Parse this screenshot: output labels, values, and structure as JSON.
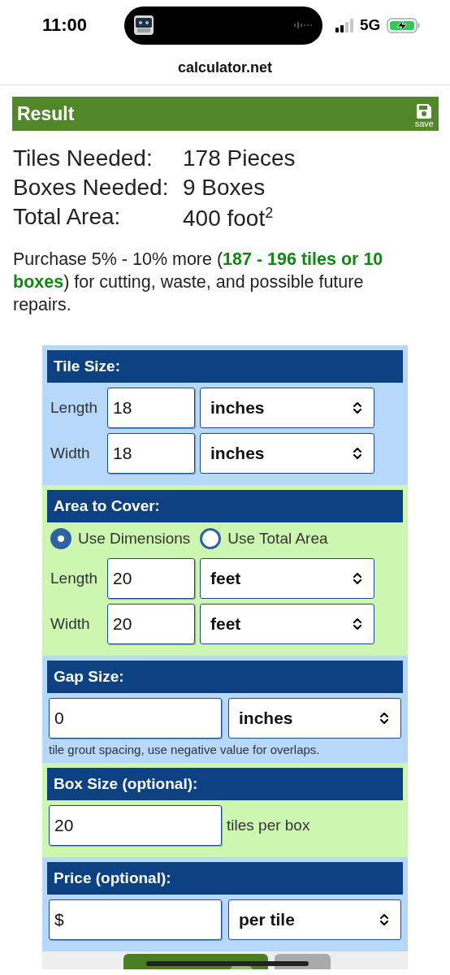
{
  "status_bar": {
    "time": "11:00",
    "network": "5G"
  },
  "browser": {
    "url": "calculator.net"
  },
  "result": {
    "title": "Result",
    "save_label": "save",
    "rows": [
      {
        "label": "Tiles Needed:",
        "value": "178 Pieces"
      },
      {
        "label": "Boxes Needed:",
        "value": "9 Boxes"
      },
      {
        "label": "Total Area:",
        "value": "400 foot$^{2}$"
      }
    ],
    "note": "Purchase 5% - 10% more (**187 - 196 tiles or 10 boxes**) for cutting, waste, and possible future repairs."
  },
  "sections": [
    {
      "title": "Tile Size:",
      "rows": [
        {
          "kind": "labeled",
          "label": "Length",
          "value": "18",
          "unit": "inches"
        },
        {
          "kind": "labeled",
          "label": "Width",
          "value": "18",
          "unit": "inches"
        }
      ]
    },
    {
      "title": "Area to Cover:",
      "radios": [
        {
          "label": "Use Dimensions",
          "selected": true
        },
        {
          "label": "Use Total Area",
          "selected": false
        }
      ],
      "rows": [
        {
          "kind": "labeled",
          "label": "Length",
          "value": "20",
          "unit": "feet"
        },
        {
          "kind": "labeled",
          "label": "Width",
          "value": "20",
          "unit": "feet"
        }
      ]
    },
    {
      "title": "Gap Size:",
      "rows": [
        {
          "kind": "wide",
          "value": "0",
          "unit": "inches"
        }
      ],
      "hint": "tile grout spacing, use negative value for overlaps."
    },
    {
      "title": "Box Size (optional):",
      "rows": [
        {
          "kind": "suffix",
          "value": "20",
          "suffix": "tiles per box"
        }
      ]
    },
    {
      "title": "Price (optional):",
      "rows": [
        {
          "kind": "wide",
          "value": "$",
          "unit": "per tile"
        }
      ]
    }
  ],
  "buttons": [
    {
      "kind": "primary"
    },
    {
      "kind": "secondary"
    }
  ]
}
